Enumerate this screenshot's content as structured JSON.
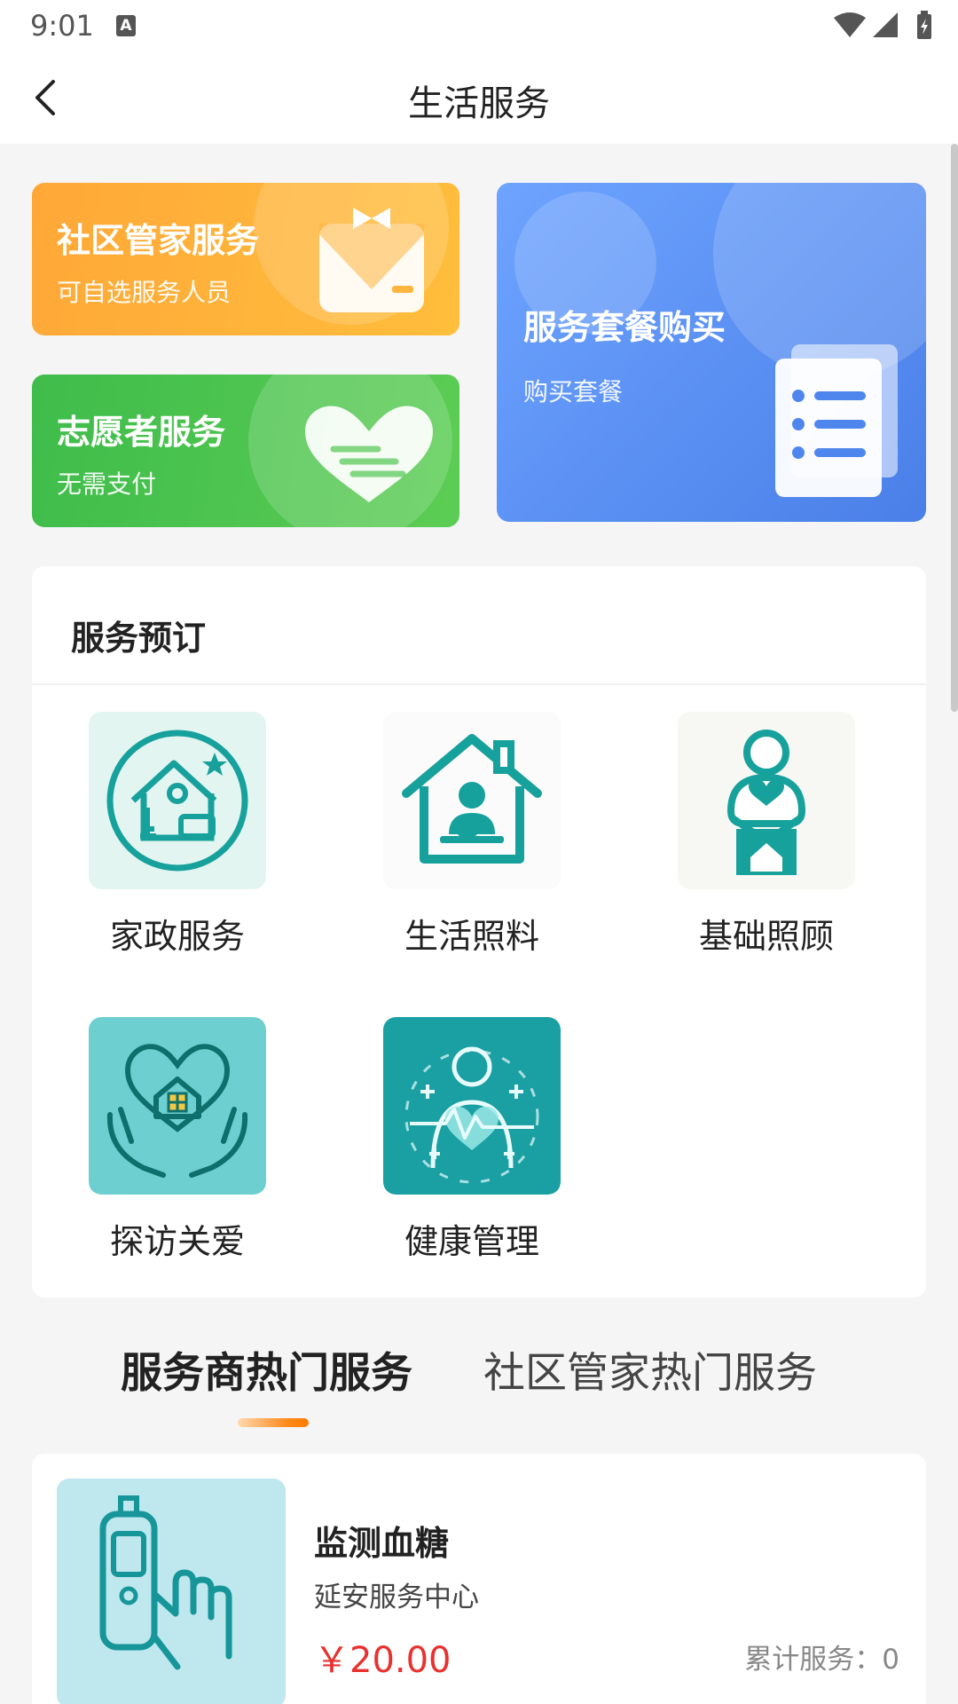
{
  "status_bar": {
    "time": "9:01",
    "notification_badge": "A",
    "icons": [
      "wifi-icon",
      "signal-icon",
      "battery-icon"
    ]
  },
  "header": {
    "title": "生活服务",
    "back_icon": "chevron-left-icon"
  },
  "promos": {
    "butler": {
      "title": "社区管家服务",
      "subtitle": "可自选服务人员",
      "icon": "butler-vest-icon",
      "color": "#ffae3a"
    },
    "volunteer": {
      "title": "志愿者服务",
      "subtitle": "无需支付",
      "icon": "heart-hand-icon",
      "color": "#4cc44f"
    },
    "package": {
      "title": "服务套餐购买",
      "subtitle": "购买套餐",
      "icon": "document-list-icon",
      "color": "#5b8ff5"
    }
  },
  "booking": {
    "title": "服务预订",
    "items": [
      {
        "label": "家政服务",
        "icon": "housekeeping-icon"
      },
      {
        "label": "生活照料",
        "icon": "daily-care-icon"
      },
      {
        "label": "基础照顾",
        "icon": "basic-care-icon"
      },
      {
        "label": "探访关爱",
        "icon": "visit-care-icon"
      },
      {
        "label": "健康管理",
        "icon": "health-management-icon"
      }
    ]
  },
  "tabs": {
    "items": [
      {
        "label": "服务商热门服务",
        "active": true
      },
      {
        "label": "社区管家热门服务",
        "active": false
      }
    ],
    "accent": "#ff8a1a"
  },
  "products": [
    {
      "name": "监测血糖",
      "provider": "延安服务中心",
      "price": "￥20.00",
      "served": "累计服务：0",
      "icon": "glucose-meter-icon"
    }
  ],
  "colors": {
    "price": "#e8322f",
    "teal": "#169e9a"
  }
}
